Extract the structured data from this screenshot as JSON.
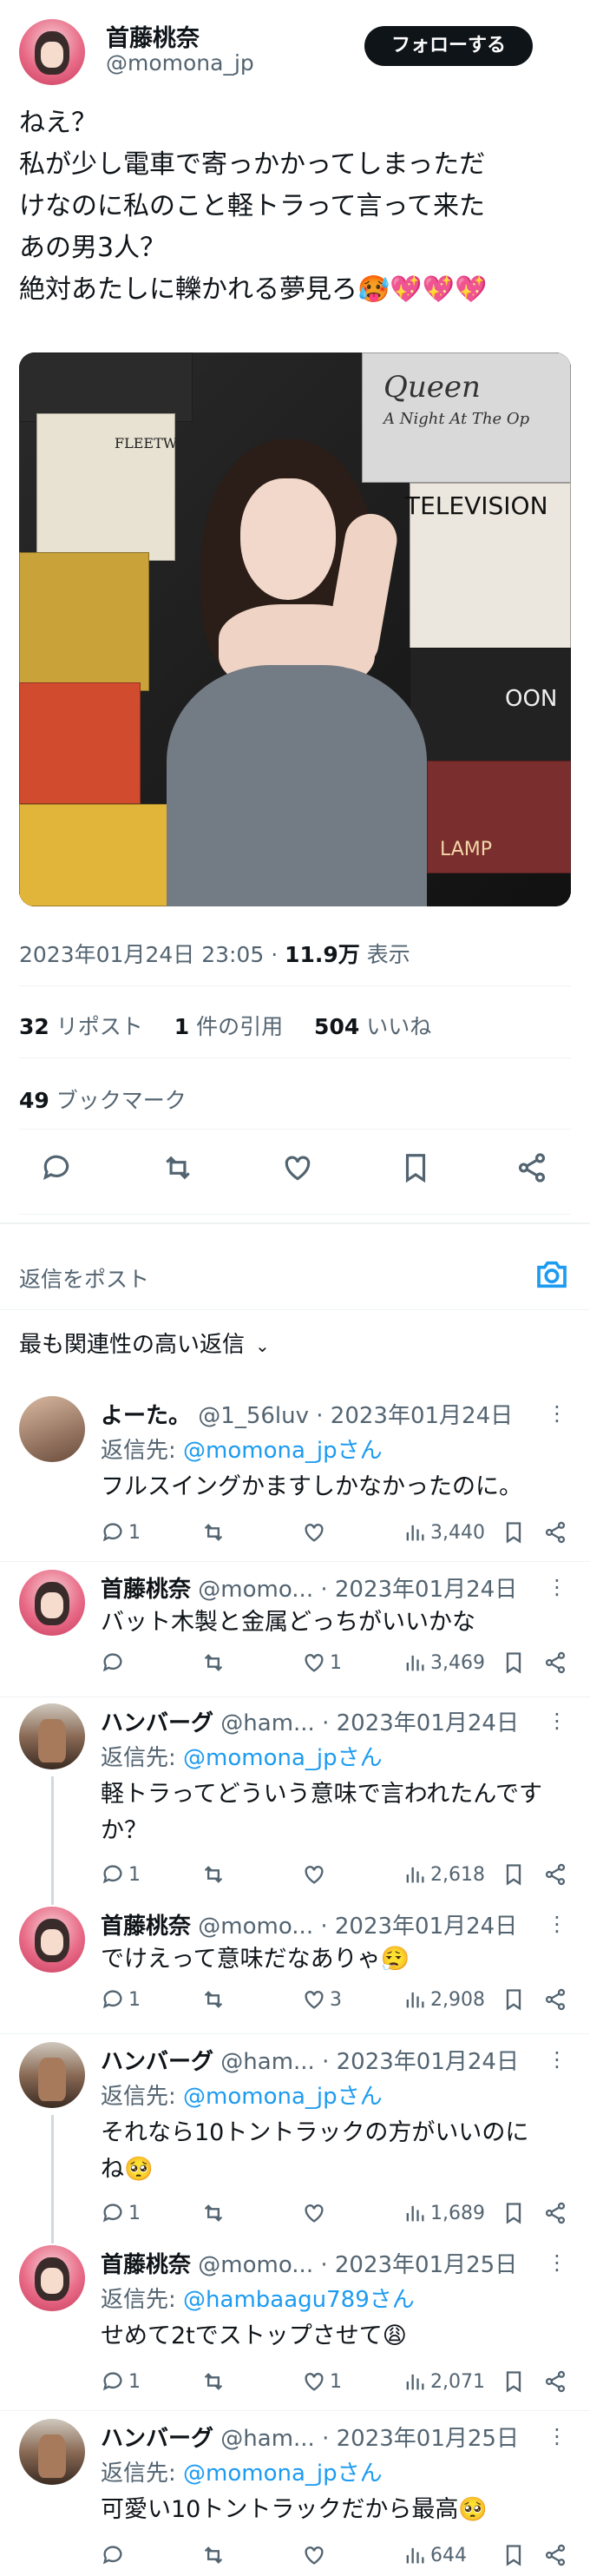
{
  "tweet": {
    "author_name": "首藤桃奈",
    "author_handle": "@momona_jp",
    "follow_label": "フォローする",
    "text_lines": [
      "ねえ？",
      "私が少し電車で寄っかかってしまっただ",
      "けなのに私のこと軽トラって言って来た",
      "あの男3人？",
      "絶対あたしに轢かれる夢見ろ🥵💖💖💖"
    ],
    "timestamp": "2023年01月24日 23:05",
    "views_value": "11.9万",
    "views_label": "表示",
    "reposts_value": "32",
    "reposts_label": "リポスト",
    "quotes_value": "1",
    "quotes_label": "件の引用",
    "likes_value": "504",
    "likes_label": "いいね",
    "bookmarks_value": "49",
    "bookmarks_label": "ブックマーク"
  },
  "media_text": {
    "queen": "Queen",
    "queen_sub": "A Night At The Op",
    "television": "TELEVISION",
    "fleetwood": "FLEETW",
    "oon": "OON",
    "lamp": "LAMP"
  },
  "reply_compose": {
    "placeholder": "返信をポスト",
    "sort_label": "最も関連性の高い返信"
  },
  "replies": [
    {
      "name": "よーた。",
      "handle": "@1_56luv · 2023年01月24日",
      "to_prefix": "返信先: ",
      "to": "@momona_jpさん",
      "body": [
        "フルスイングかますしかなかったのに。"
      ],
      "replies": "1",
      "reposts": "",
      "likes": "",
      "views": "3,440"
    },
    {
      "name": "首藤桃奈",
      "handle": "@momo... · 2023年01月24日",
      "to_prefix": "",
      "to": "",
      "body": [
        "バット木製と金属どっちがいいかな"
      ],
      "replies": "",
      "reposts": "",
      "likes": "1",
      "views": "3,469"
    },
    {
      "name": "ハンバーグ",
      "handle": "@ham... · 2023年01月24日",
      "to_prefix": "返信先: ",
      "to": "@momona_jpさん",
      "body": [
        "軽トラってどういう意味で言われたんです",
        "か？"
      ],
      "replies": "1",
      "reposts": "",
      "likes": "",
      "views": "2,618"
    },
    {
      "name": "首藤桃奈",
      "handle": "@momo... · 2023年01月24日",
      "to_prefix": "",
      "to": "",
      "body": [
        "でけえって意味だなありゃ😮‍💨"
      ],
      "replies": "1",
      "reposts": "",
      "likes": "3",
      "views": "2,908"
    },
    {
      "name": "ハンバーグ",
      "handle": "@ham... · 2023年01月24日",
      "to_prefix": "返信先: ",
      "to": "@momona_jpさん",
      "body": [
        "それなら10トントラックの方がいいのに",
        "ね🥺"
      ],
      "replies": "1",
      "reposts": "",
      "likes": "",
      "views": "1,689"
    },
    {
      "name": "首藤桃奈",
      "handle": "@momo... · 2023年01月25日",
      "to_prefix": "返信先: ",
      "to": "@hambaagu789さん",
      "body": [
        "せめて2tでストップさせて😩"
      ],
      "replies": "1",
      "reposts": "",
      "likes": "1",
      "views": "2,071"
    },
    {
      "name": "ハンバーグ",
      "handle": "@ham... · 2023年01月25日",
      "to_prefix": "返信先: ",
      "to": "@momona_jpさん",
      "body": [
        "可愛い10トントラックだから最高🥺"
      ],
      "replies": "",
      "reposts": "",
      "likes": "",
      "views": "644"
    }
  ]
}
